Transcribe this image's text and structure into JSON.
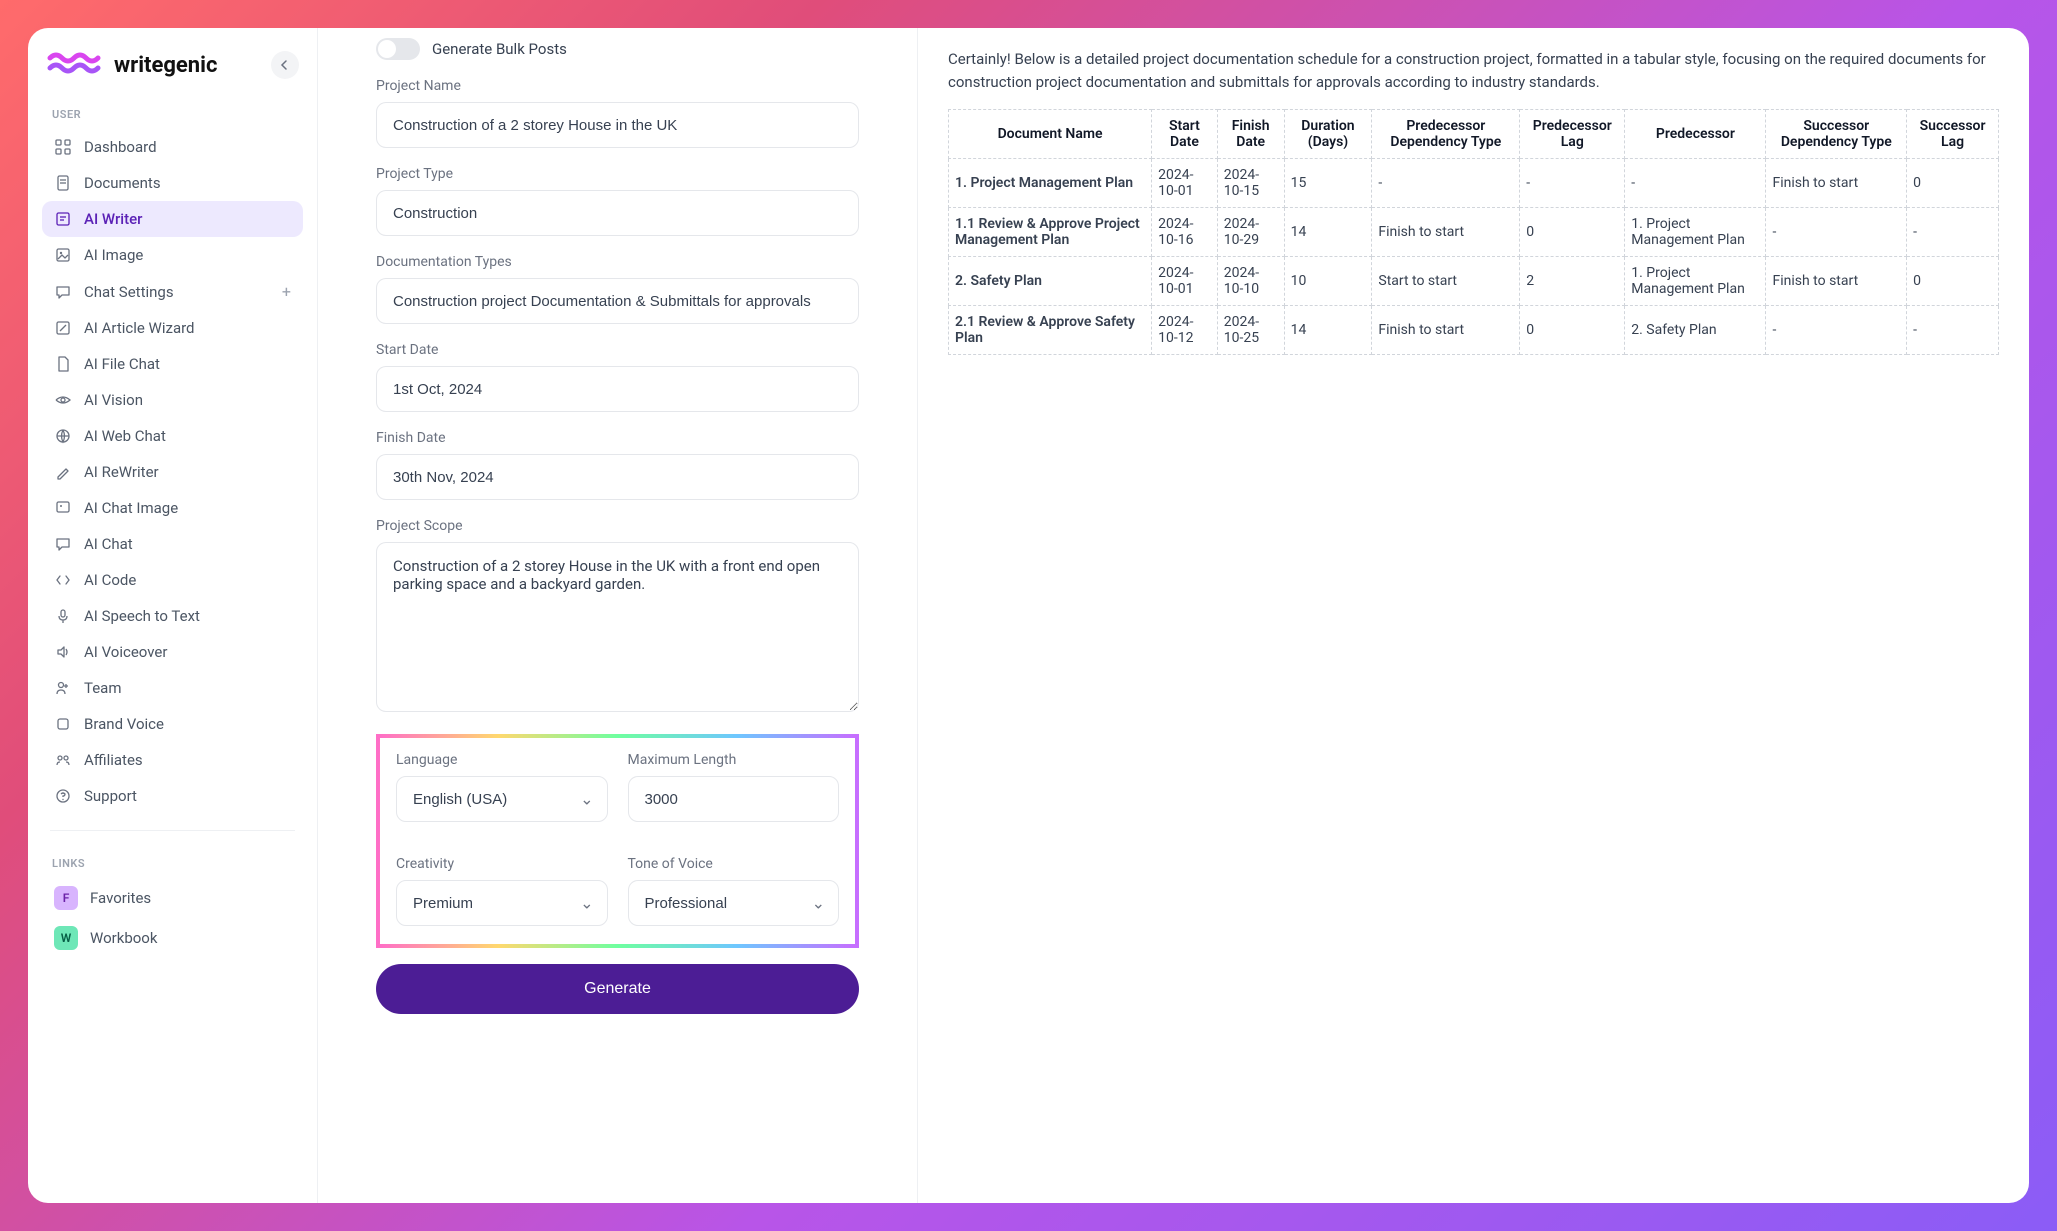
{
  "brand": {
    "name": "writegenic"
  },
  "sidebar": {
    "sections": {
      "user_label": "USER",
      "links_label": "LINKS"
    },
    "items": [
      {
        "label": "Dashboard"
      },
      {
        "label": "Documents"
      },
      {
        "label": "AI Writer"
      },
      {
        "label": "AI Image"
      },
      {
        "label": "Chat Settings"
      },
      {
        "label": "AI Article Wizard"
      },
      {
        "label": "AI File Chat"
      },
      {
        "label": "AI Vision"
      },
      {
        "label": "AI Web Chat"
      },
      {
        "label": "AI ReWriter"
      },
      {
        "label": "AI Chat Image"
      },
      {
        "label": "AI Chat"
      },
      {
        "label": "AI Code"
      },
      {
        "label": "AI Speech to Text"
      },
      {
        "label": "AI Voiceover"
      },
      {
        "label": "Team"
      },
      {
        "label": "Brand Voice"
      },
      {
        "label": "Affiliates"
      },
      {
        "label": "Support"
      }
    ],
    "links": [
      {
        "badge": "F",
        "label": "Favorites"
      },
      {
        "badge": "W",
        "label": "Workbook"
      }
    ]
  },
  "form": {
    "bulk_toggle_label": "Generate Bulk Posts",
    "project_name_label": "Project Name",
    "project_name_value": "Construction of a 2 storey House in the UK",
    "project_type_label": "Project Type",
    "project_type_value": "Construction",
    "doc_types_label": "Documentation Types",
    "doc_types_value": "Construction project Documentation & Submittals for approvals",
    "start_date_label": "Start Date",
    "start_date_value": "1st Oct, 2024",
    "finish_date_label": "Finish Date",
    "finish_date_value": "30th Nov, 2024",
    "scope_label": "Project Scope",
    "scope_value": "Construction of a 2 storey House in the UK with a front end open parking space and a backyard garden.",
    "language_label": "Language",
    "language_value": "English (USA)",
    "maxlen_label": "Maximum Length",
    "maxlen_value": "3000",
    "creativity_label": "Creativity",
    "creativity_value": "Premium",
    "tone_label": "Tone of Voice",
    "tone_value": "Professional",
    "generate_label": "Generate"
  },
  "output": {
    "intro": "Certainly! Below is a detailed project documentation schedule for a construction project, formatted in a tabular style, focusing on the required documents for construction project documentation and submittals for approvals according to industry standards.",
    "headers": [
      "Document Name",
      "Start Date",
      "Finish Date",
      "Duration (Days)",
      "Predecessor Dependency Type",
      "Predecessor Lag",
      "Predecessor",
      "Successor Dependency Type",
      "Successor Lag"
    ],
    "rows": [
      {
        "doc": "1. Project Management Plan",
        "start": "2024-10-01",
        "finish": "2024-10-15",
        "duration": "15",
        "pdep": "-",
        "plag": "-",
        "pred": "-",
        "sdep": "Finish to start",
        "slag": "0"
      },
      {
        "doc": "1.1 Review & Approve Project Management Plan",
        "start": "2024-10-16",
        "finish": "2024-10-29",
        "duration": "14",
        "pdep": "Finish to start",
        "plag": "0",
        "pred": "1. Project Management Plan",
        "sdep": "-",
        "slag": "-"
      },
      {
        "doc": "2. Safety Plan",
        "start": "2024-10-01",
        "finish": "2024-10-10",
        "duration": "10",
        "pdep": "Start to start",
        "plag": "2",
        "pred": "1. Project Management Plan",
        "sdep": "Finish to start",
        "slag": "0"
      },
      {
        "doc": "2.1 Review & Approve Safety Plan",
        "start": "2024-10-12",
        "finish": "2024-10-25",
        "duration": "14",
        "pdep": "Finish to start",
        "plag": "0",
        "pred": "2. Safety Plan",
        "sdep": "-",
        "slag": "-"
      }
    ]
  }
}
